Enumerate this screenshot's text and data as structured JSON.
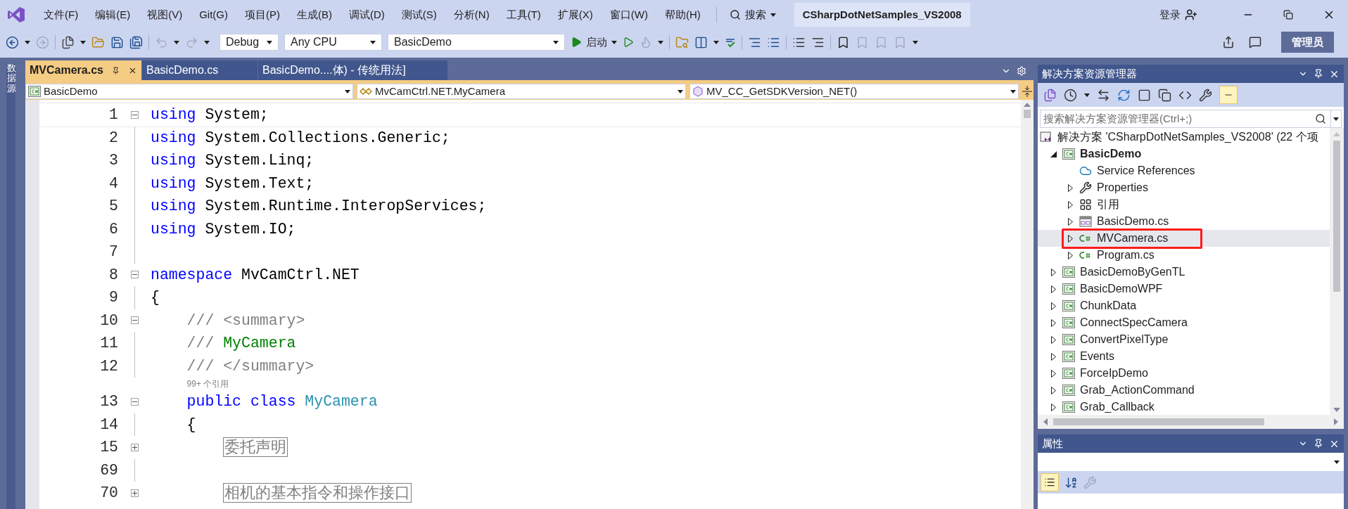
{
  "menu": [
    "文件(F)",
    "编辑(E)",
    "视图(V)",
    "Git(G)",
    "项目(P)",
    "生成(B)",
    "调试(D)",
    "测试(S)",
    "分析(N)",
    "工具(T)",
    "扩展(X)",
    "窗口(W)",
    "帮助(H)"
  ],
  "search": "搜索",
  "title": "CSharpDotNetSamples_VS2008",
  "login": "登录",
  "admin": "管理员",
  "toolbar": {
    "configuration": "Debug",
    "platform": "Any CPU",
    "startup": "BasicDemo",
    "start": "启动"
  },
  "side_strip": "数据源",
  "tabs": [
    {
      "label": "MVCamera.cs",
      "selected": true
    },
    {
      "label": "BasicDemo.cs",
      "selected": false
    },
    {
      "label": "BasicDemo....体) - 传统用法]",
      "selected": false
    }
  ],
  "nav": [
    "BasicDemo",
    "MvCamCtrl.NET.MyCamera",
    "MV_CC_GetSDKVersion_NET()"
  ],
  "lines": [
    {
      "kind": "code",
      "number": "1",
      "collapsed": false,
      "tokens": [
        {
          "kind": "keyword",
          "text": "using"
        },
        {
          "kind": "plain",
          "text": " System;"
        }
      ]
    },
    {
      "kind": "code",
      "number": "2",
      "tokens": [
        {
          "kind": "keyword",
          "text": "using"
        },
        {
          "kind": "plain",
          "text": " System.Collections.Generic;"
        }
      ]
    },
    {
      "kind": "code",
      "number": "3",
      "tokens": [
        {
          "kind": "keyword",
          "text": "using"
        },
        {
          "kind": "plain",
          "text": " System.Linq;"
        }
      ]
    },
    {
      "kind": "code",
      "number": "4",
      "tokens": [
        {
          "kind": "keyword",
          "text": "using"
        },
        {
          "kind": "plain",
          "text": " System.Text;"
        }
      ]
    },
    {
      "kind": "code",
      "number": "5",
      "tokens": [
        {
          "kind": "keyword",
          "text": "using"
        },
        {
          "kind": "plain",
          "text": " System.Runtime.InteropServices;"
        }
      ]
    },
    {
      "kind": "code",
      "number": "6",
      "tokens": [
        {
          "kind": "keyword",
          "text": "using"
        },
        {
          "kind": "plain",
          "text": " System.IO;"
        }
      ]
    },
    {
      "kind": "code",
      "number": "7"
    },
    {
      "kind": "code",
      "number": "8",
      "collapsed": false,
      "tokens": [
        {
          "kind": "keyword",
          "text": "namespace"
        },
        {
          "kind": "plain",
          "text": " MvCamCtrl.NET"
        }
      ]
    },
    {
      "kind": "code",
      "number": "9",
      "tokens": [
        {
          "kind": "plain",
          "text": "{"
        }
      ]
    },
    {
      "kind": "code",
      "number": "10",
      "collapsed": false,
      "tokens": [
        {
          "kind": "comment",
          "text": "    /// <summary>"
        }
      ]
    },
    {
      "kind": "code",
      "number": "11",
      "tokens": [
        {
          "kind": "comment",
          "text": "    /// "
        },
        {
          "kind": "doc",
          "text": "MyCamera"
        }
      ]
    },
    {
      "kind": "code",
      "number": "12",
      "tokens": [
        {
          "kind": "comment",
          "text": "    /// </summary>"
        }
      ]
    },
    {
      "kind": "codelens",
      "text": "    99+ 个引用"
    },
    {
      "kind": "code",
      "number": "13",
      "collapsed": false,
      "tokens": [
        {
          "kind": "keyword",
          "text": "    public class "
        },
        {
          "kind": "type",
          "text": "MyCamera"
        }
      ]
    },
    {
      "kind": "code",
      "number": "14",
      "tokens": [
        {
          "kind": "plain",
          "text": "    {"
        }
      ]
    },
    {
      "kind": "code",
      "number": "15",
      "collapsed": true,
      "tokens": [
        {
          "kind": "region",
          "text": "        委托声明"
        }
      ]
    },
    {
      "kind": "code",
      "number": "69"
    },
    {
      "kind": "code",
      "number": "70",
      "collapsed": true,
      "tokens": [
        {
          "kind": "region",
          "text": "        相机的基本指令和操作接口"
        }
      ]
    }
  ],
  "solution_explorer": {
    "title": "解决方案资源管理器",
    "search_placeholder": "搜索解决方案资源管理器(Ctrl+;)",
    "tree": [
      {
        "label": "解决方案 'CSharpDotNetSamples_VS2008' (22 个项",
        "kind": "solution",
        "selected": false,
        "marked": false,
        "startup": false,
        "children": [
          {
            "label": "BasicDemo",
            "kind": "project",
            "expanded": true,
            "selected": false,
            "marked": false,
            "startup": true,
            "children": [
              {
                "label": "Service References",
                "kind": "service",
                "selected": false,
                "marked": false,
                "startup": false
              },
              {
                "label": "Properties",
                "kind": "properties",
                "expanded": false,
                "selected": false,
                "marked": false,
                "startup": false
              },
              {
                "label": "引用",
                "kind": "references",
                "expanded": false,
                "selected": false,
                "marked": false,
                "startup": false
              },
              {
                "label": "BasicDemo.cs",
                "kind": "form",
                "expanded": false,
                "selected": false,
                "marked": false,
                "startup": false
              },
              {
                "label": "MVCamera.cs",
                "kind": "cs",
                "expanded": false,
                "selected": true,
                "marked": true,
                "startup": false
              },
              {
                "label": "Program.cs",
                "kind": "cs",
                "expanded": false,
                "selected": false,
                "marked": false,
                "startup": false
              }
            ]
          },
          {
            "label": "BasicDemoByGenTL",
            "kind": "project",
            "expanded": false,
            "selected": false,
            "marked": false,
            "startup": false
          },
          {
            "label": "BasicDemoWPF",
            "kind": "project",
            "expanded": false,
            "selected": false,
            "marked": false,
            "startup": false
          },
          {
            "label": "ChunkData",
            "kind": "project",
            "expanded": false,
            "selected": false,
            "marked": false,
            "startup": false
          },
          {
            "label": "ConnectSpecCamera",
            "kind": "project",
            "expanded": false,
            "selected": false,
            "marked": false,
            "startup": false
          },
          {
            "label": "ConvertPixelType",
            "kind": "project",
            "expanded": false,
            "selected": false,
            "marked": false,
            "startup": false
          },
          {
            "label": "Events",
            "kind": "project",
            "expanded": false,
            "selected": false,
            "marked": false,
            "startup": false
          },
          {
            "label": "ForceIpDemo",
            "kind": "project",
            "expanded": false,
            "selected": false,
            "marked": false,
            "startup": false
          },
          {
            "label": "Grab_ActionCommand",
            "kind": "project",
            "expanded": false,
            "selected": false,
            "marked": false,
            "startup": false
          },
          {
            "label": "Grab_Callback",
            "kind": "project",
            "expanded": false,
            "selected": false,
            "marked": false,
            "startup": false
          }
        ]
      }
    ]
  },
  "properties": {
    "title": "属性"
  }
}
